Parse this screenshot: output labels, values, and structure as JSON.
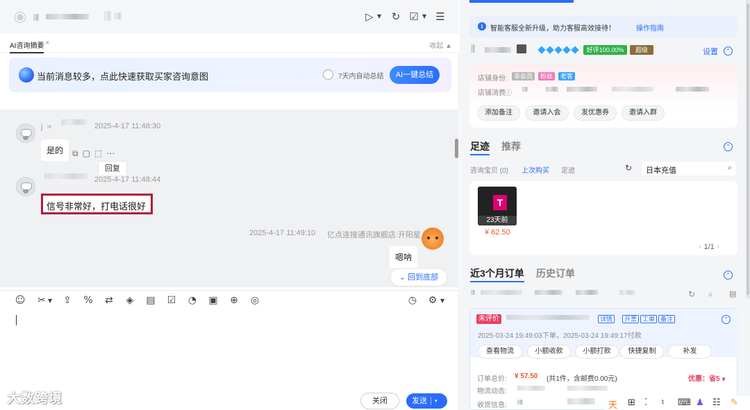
{
  "chat_header": {
    "icons": [
      "video-call-icon",
      "clock-refresh-icon",
      "task-check-icon",
      "menu-icon"
    ]
  },
  "ai_summary": {
    "tab_label": "AI咨询摘要",
    "tab_close": "×",
    "collapse_label": "收起 ▲",
    "banner_text": "当前消息较多，点此快速获取买家咨询意图",
    "auto_summary_label": "7天内自动总结",
    "one_click_button": "AI一键总结"
  },
  "messages": [
    {
      "sender": "j",
      "time": "2025-4-17 11:48:30",
      "text": "是的"
    },
    {
      "sender": "",
      "time": "2025-4-17 11:48:44",
      "text": "信号非常好，打电话很好"
    },
    {
      "sender": "亿点连接通讯旗舰店:开阳星",
      "time": "2025-4-17 11:49:10",
      "text": "嗯呐"
    }
  ],
  "message_actions": {
    "reply_tooltip": "回复"
  },
  "back_to_bottom": "回到底部",
  "composer": {
    "close_button": "关闭",
    "send_button": "发送",
    "send_dropdown": "▾"
  },
  "watermark": "大数跨境",
  "right_panel": {
    "notice_text": "智能客服全新升级，助力客服高效接待！",
    "notice_link": "操作指南",
    "customer": {
      "good_rate_badge": "好评100.00%",
      "level_badge": "超级",
      "settings_label": "设置"
    },
    "store_identity_label": "店铺身份:",
    "identity_tags": [
      {
        "label": "非会员",
        "color": "#b7b7b7"
      },
      {
        "label": "粉丝",
        "color": "#f07ab8"
      },
      {
        "label": "老客",
        "color": "#3aa3ff"
      }
    ],
    "store_spend_label": "店铺消费",
    "actions": [
      "添加备注",
      "邀请入会",
      "发优惠券",
      "邀请入群"
    ],
    "footprint": {
      "tab_active": "足迹",
      "tab_inactive": "推荐",
      "sub_tabs": [
        "咨询宝贝 (0)",
        "上次购买",
        "足迹"
      ],
      "search_value": "日本充值",
      "product_days": "23天前",
      "product_price": "¥ 62.50",
      "pager": "1/1"
    },
    "orders": {
      "tab_active": "近3个月订单",
      "tab_inactive": "历史订单",
      "unrated_badge": "未评价",
      "order_tags": [
        "详情",
        "开票",
        "工单",
        "备注"
      ],
      "order_time": "2025-03-24 19:49:03下单，2025-03-24 19:49:17付款",
      "order_actions": [
        "查看物流",
        "小额收款",
        "小额打款",
        "快捷复制",
        "补发"
      ],
      "total_label": "订单总价:",
      "total_value": "¥ 57.50",
      "total_meta": "(共1件，含邮费0.00元)",
      "discount": "优惠：省5",
      "logistics_label": "物流动态:",
      "receiver_label": "收货信息:"
    }
  }
}
